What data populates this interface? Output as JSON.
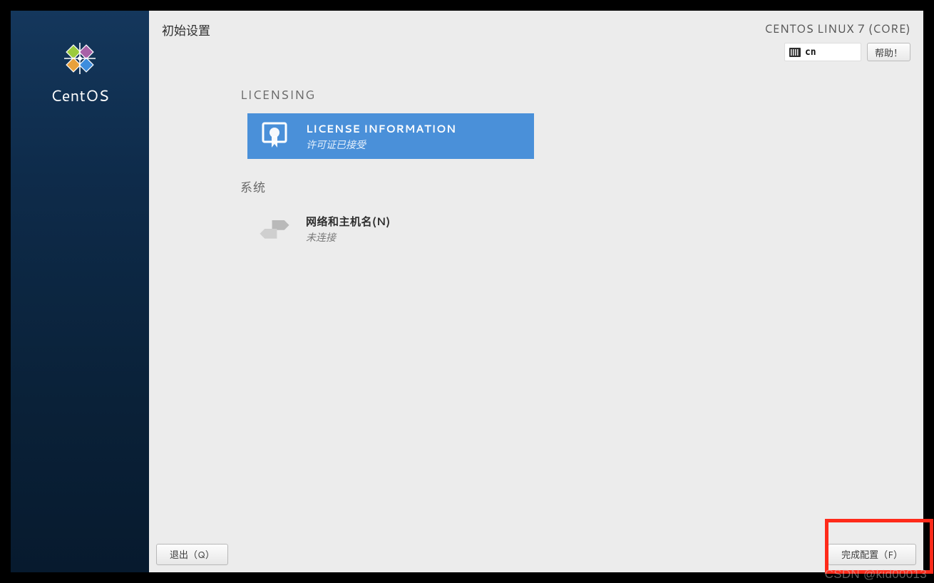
{
  "sidebar": {
    "brand": "CentOS"
  },
  "header": {
    "title": "初始设置",
    "os_label": "CENTOS LINUX 7 (CORE)",
    "language_code": "cn",
    "help_label": "帮助！"
  },
  "sections": {
    "licensing": {
      "heading": "LICENSING",
      "spoke": {
        "title": "LICENSE INFORMATION",
        "status": "许可证已接受"
      }
    },
    "system": {
      "heading": "系统",
      "spoke": {
        "title": "网络和主机名(N)",
        "status": "未连接"
      }
    }
  },
  "footer": {
    "quit_label": "退出（Q）",
    "finish_label": "完成配置（F）"
  },
  "watermark": "CSDN @kid00013",
  "colors": {
    "selected_bg": "#4a90d9",
    "highlight_border": "#ff2a1a"
  }
}
